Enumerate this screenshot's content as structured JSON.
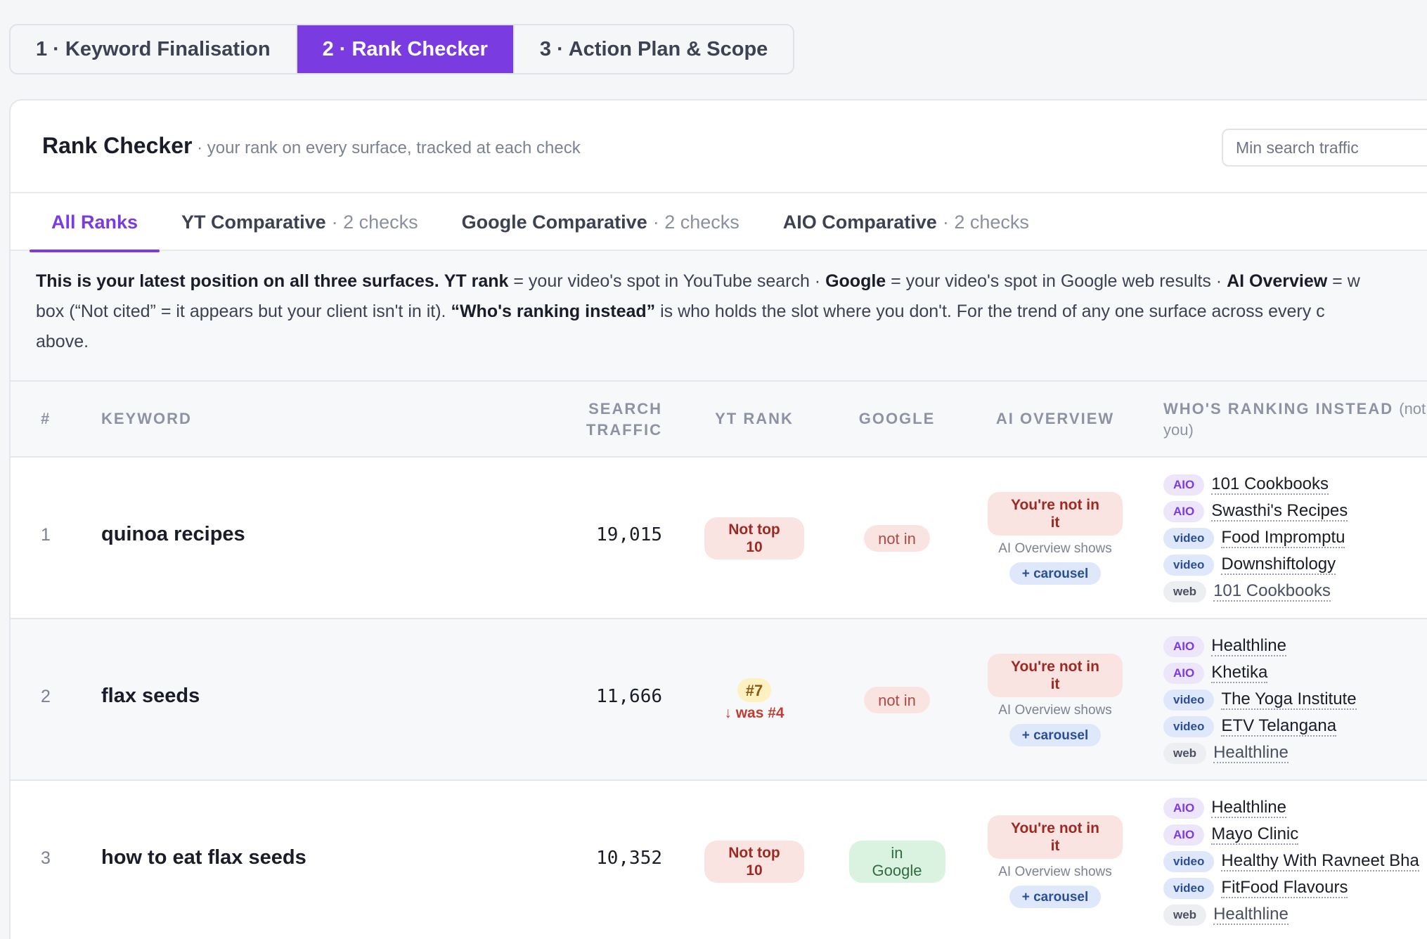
{
  "steps": [
    {
      "label": "1 · Keyword Finalisation"
    },
    {
      "label": "2 · Rank Checker"
    },
    {
      "label": "3 · Action Plan & Scope"
    }
  ],
  "header": {
    "title": "Rank Checker",
    "subtitle": " · your rank on every surface, tracked at each check",
    "min_traffic_placeholder": "Min search traffic"
  },
  "subtabs": [
    {
      "label": "All Ranks",
      "meta": ""
    },
    {
      "label": "YT Comparative",
      "meta": "· 2 checks"
    },
    {
      "label": "Google Comparative",
      "meta": "· 2 checks"
    },
    {
      "label": "AIO Comparative",
      "meta": "· 2 checks"
    }
  ],
  "info": {
    "b1": "This is your latest position on all three surfaces.",
    "b2": "YT rank",
    "t2": " = your video's spot in YouTube search · ",
    "b3": "Google",
    "t3": " = your video's spot in Google web results · ",
    "b4": "AI Overview",
    "t4": " = w",
    "t5": "box (“Not cited” = it appears but your client isn't in it). ",
    "b5": "“Who's ranking instead”",
    "t6": " is who holds the slot where you don't. For the trend of any one surface across every c",
    "t7": "above."
  },
  "columns": {
    "num": "#",
    "keyword": "KEYWORD",
    "traffic_1": "SEARCH",
    "traffic_2": "TRAFFIC",
    "yt": "YT RANK",
    "google": "GOOGLE",
    "aio": "AI OVERVIEW",
    "who": "WHO'S RANKING INSTEAD",
    "who_note_1": "(not",
    "who_note_2": "you)"
  },
  "rows": [
    {
      "num": "1",
      "keyword": "quinoa recipes",
      "traffic": "19,015",
      "yt_1": "Not top",
      "yt_2": "10",
      "google": "not in",
      "aio_1": "You're not in",
      "aio_2": "it",
      "aio_shows": "AI Overview shows",
      "aio_extra": "+ carousel",
      "who": [
        {
          "tag": "AIO",
          "name": "101 Cookbooks"
        },
        {
          "tag": "AIO",
          "name": "Swasthi's Recipes"
        },
        {
          "tag": "video",
          "name": "Food Impromptu"
        },
        {
          "tag": "video",
          "name": "Downshiftology"
        },
        {
          "tag": "web",
          "name": "101 Cookbooks"
        }
      ]
    },
    {
      "num": "2",
      "keyword": "flax seeds",
      "traffic": "11,666",
      "yt_rank": "#7",
      "yt_trend": "↓ was #4",
      "google": "not in",
      "aio_1": "You're not in",
      "aio_2": "it",
      "aio_shows": "AI Overview shows",
      "aio_extra": "+ carousel",
      "who": [
        {
          "tag": "AIO",
          "name": "Healthline"
        },
        {
          "tag": "AIO",
          "name": "Khetika"
        },
        {
          "tag": "video",
          "name": "The Yoga Institute"
        },
        {
          "tag": "video",
          "name": "ETV Telangana"
        },
        {
          "tag": "web",
          "name": "Healthline"
        }
      ]
    },
    {
      "num": "3",
      "keyword": "how to eat flax seeds",
      "traffic": "10,352",
      "yt_1": "Not top",
      "yt_2": "10",
      "google_1": "in",
      "google_2": "Google",
      "aio_1": "You're not in",
      "aio_2": "it",
      "aio_shows": "AI Overview shows",
      "aio_extra": "+ carousel",
      "who": [
        {
          "tag": "AIO",
          "name": "Healthline"
        },
        {
          "tag": "AIO",
          "name": "Mayo Clinic"
        },
        {
          "tag": "video",
          "name": "Healthy With Ravneet Bha"
        },
        {
          "tag": "video",
          "name": "FitFood Flavours"
        },
        {
          "tag": "web",
          "name": "Healthline"
        }
      ]
    }
  ],
  "colors": {
    "accent": "#7a3be0",
    "danger_bg": "#fae4e2",
    "success_bg": "#daf3e1",
    "info_bg": "#dfe8fb"
  }
}
